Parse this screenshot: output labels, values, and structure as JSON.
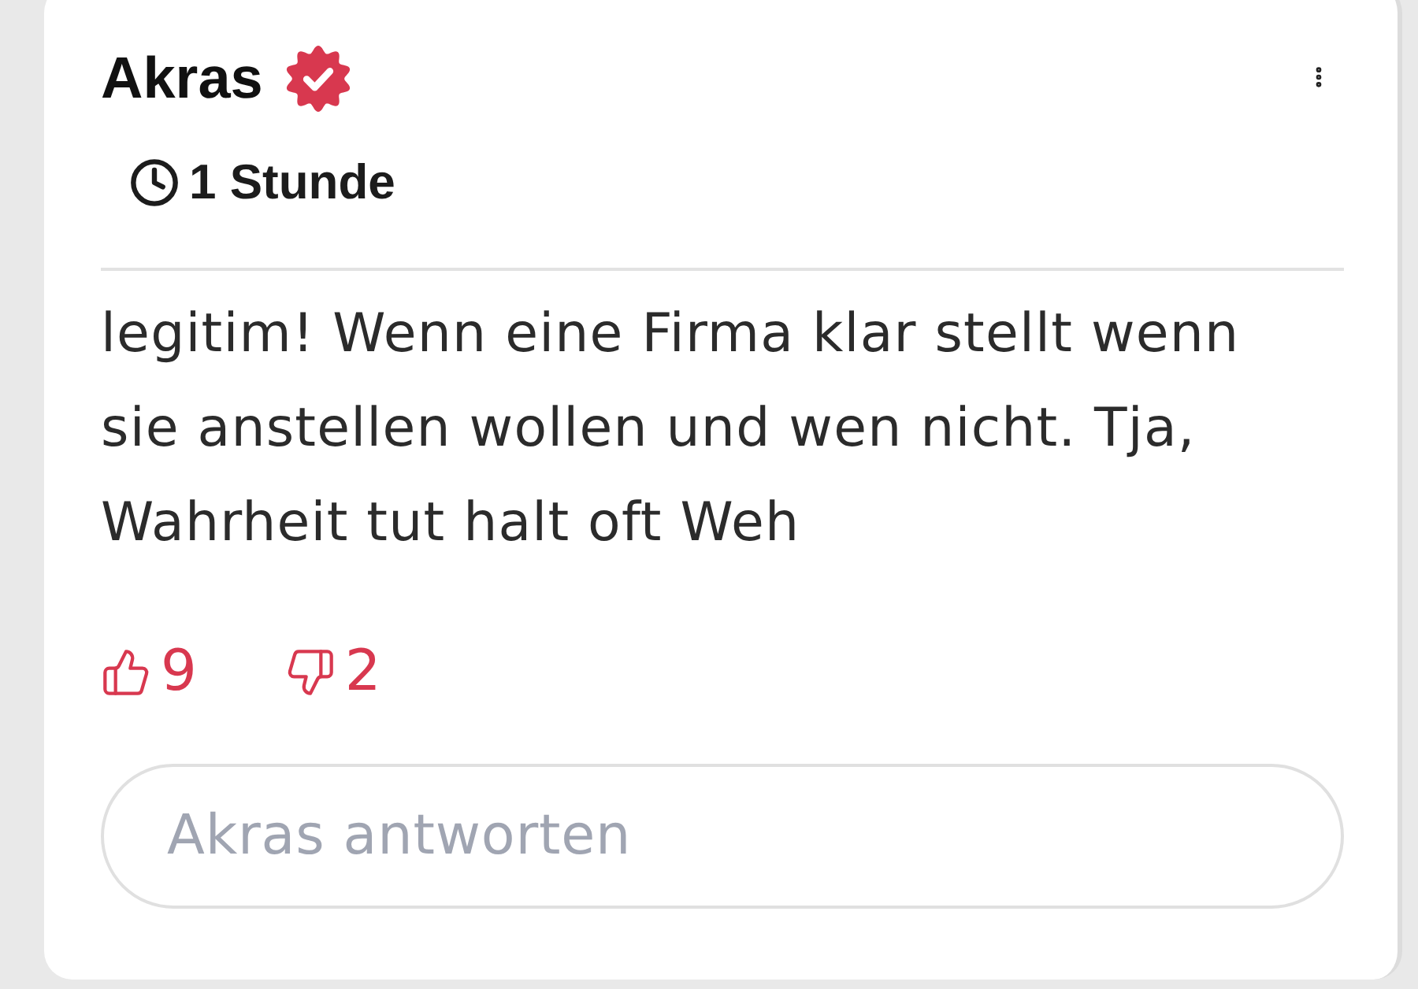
{
  "comment": {
    "author": "Akras",
    "verified": true,
    "time": "1 Stunde",
    "text": "legitim! Wenn eine Firma klar stellt wenn sie anstellen wollen und wen nicht. Tja, Wahrheit tut halt oft Weh",
    "likes": "9",
    "dislikes": "2"
  },
  "reply_field": {
    "placeholder": "Akras antworten"
  }
}
